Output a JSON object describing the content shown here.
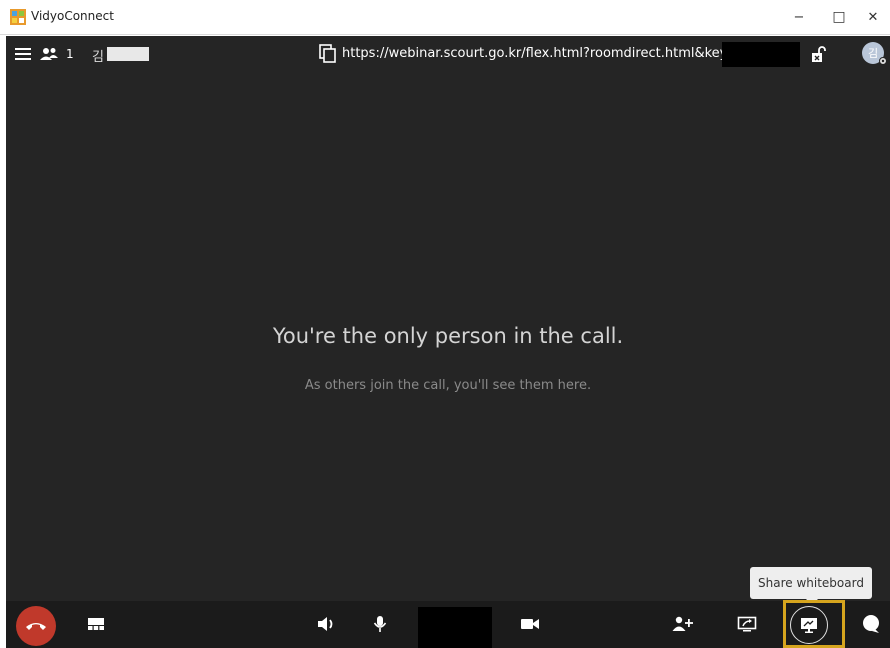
{
  "window": {
    "title": "VidyoConnect",
    "minimize_glyph": "−",
    "maximize_glyph": "□",
    "close_glyph": "✕"
  },
  "topbar": {
    "participant_count": "1",
    "user_initial": "김",
    "room_url": "https://webinar.scourt.go.kr/flex.html?roomdirect.html&key=",
    "avatar_initial": "김"
  },
  "stage": {
    "headline": "You're the only person in the call.",
    "subtext": "As others join the call, you'll see them here."
  },
  "tooltip": {
    "text": "Share whiteboard"
  },
  "colors": {
    "background": "#252525",
    "toolbar": "#1b1b1b",
    "hangup": "#c0392b",
    "highlight": "#d6a51e"
  },
  "icons": [
    "menu-icon",
    "participants-icon",
    "copy-icon",
    "lock-icon",
    "avatar-settings-icon",
    "hangup-icon",
    "layout-icon",
    "speaker-icon",
    "microphone-icon",
    "camera-icon",
    "invite-icon",
    "share-screen-icon",
    "whiteboard-icon",
    "chat-icon"
  ]
}
